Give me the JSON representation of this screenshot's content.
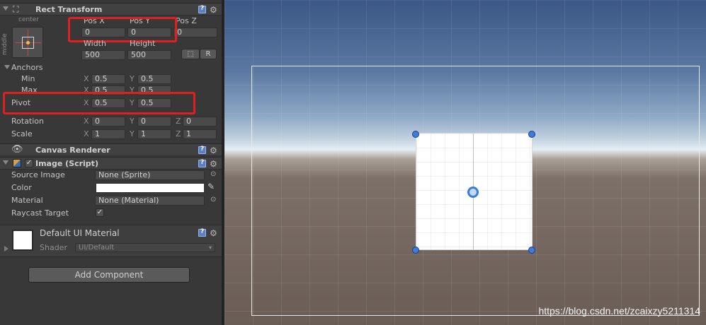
{
  "rect_transform": {
    "title": "Rect Transform",
    "anchor_preset_h": "center",
    "anchor_preset_v": "middle",
    "pos_x_label": "Pos X",
    "pos_y_label": "Pos Y",
    "pos_z_label": "Pos Z",
    "pos_x": "0",
    "pos_y": "0",
    "pos_z": "0",
    "width_label": "Width",
    "height_label": "Height",
    "width": "500",
    "height": "500",
    "raw_button": "R",
    "anchors_label": "Anchors",
    "min_label": "Min",
    "max_label": "Max",
    "anchor_min_x": "0.5",
    "anchor_min_y": "0.5",
    "anchor_max_x": "0.5",
    "anchor_max_y": "0.5",
    "pivot_label": "Pivot",
    "pivot_x": "0.5",
    "pivot_y": "0.5",
    "rotation_label": "Rotation",
    "rot_x": "0",
    "rot_y": "0",
    "rot_z": "0",
    "scale_label": "Scale",
    "scale_x": "1",
    "scale_y": "1",
    "scale_z": "1",
    "axis_x": "X",
    "axis_y": "Y",
    "axis_z": "Z"
  },
  "canvas_renderer": {
    "title": "Canvas Renderer"
  },
  "image_script": {
    "title": "Image (Script)",
    "source_image_label": "Source Image",
    "source_image_value": "None (Sprite)",
    "color_label": "Color",
    "color_value": "#ffffff",
    "material_label": "Material",
    "material_value": "None (Material)",
    "raycast_label": "Raycast Target",
    "raycast_checked": "✓"
  },
  "material": {
    "name": "Default UI Material",
    "shader_label": "Shader",
    "shader_value": "UI/Default"
  },
  "add_component": "Add Component",
  "watermark": "https://blog.csdn.net/zcaixzy5211314"
}
